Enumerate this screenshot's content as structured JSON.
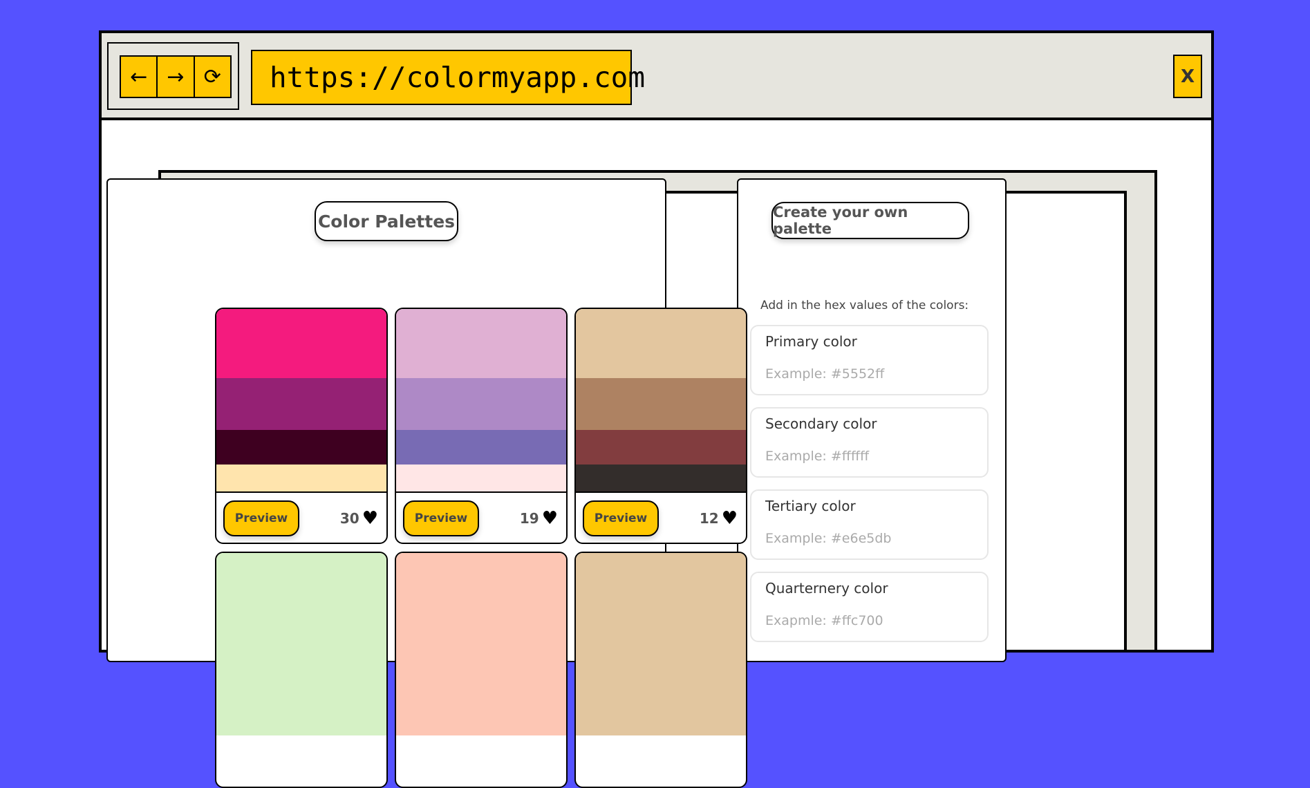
{
  "browser": {
    "nav": {
      "back": "←",
      "forward": "→",
      "reload": "⟳"
    },
    "url": "https://colormyapp.com",
    "close_label": "X"
  },
  "palettes_section": {
    "title": "Color Palettes",
    "palettes": [
      {
        "colors": [
          "#f41b7e",
          "#952174",
          "#3e0020",
          "#ffe4ad"
        ],
        "preview_label": "Preview",
        "likes": "30"
      },
      {
        "colors": [
          "#e0b0d3",
          "#ae89c6",
          "#786bb4",
          "#ffe6e6"
        ],
        "preview_label": "Preview",
        "likes": "19"
      },
      {
        "colors": [
          "#e3c69f",
          "#ae8262",
          "#823d3f",
          "#332d2b"
        ],
        "preview_label": "Preview",
        "likes": "12"
      },
      {
        "colors": [
          "#d5f1c5"
        ]
      },
      {
        "colors": [
          "#fdc6b4"
        ]
      },
      {
        "colors": [
          "#e2c69f"
        ]
      }
    ]
  },
  "create_section": {
    "title": "Create your own palette",
    "hint": "Add in the hex values of the colors:",
    "fields": [
      {
        "label": "Primary color",
        "placeholder": "Example: #5552ff"
      },
      {
        "label": "Secondary color",
        "placeholder": "Example: #ffffff"
      },
      {
        "label": "Tertiary color",
        "placeholder": "Example: #e6e5db"
      },
      {
        "label": "Quarternery color",
        "placeholder": "Exapmle: #ffc700"
      }
    ]
  },
  "colors": {
    "background": "#5552ff",
    "accent": "#ffc700",
    "panel": "#e6e5de"
  }
}
